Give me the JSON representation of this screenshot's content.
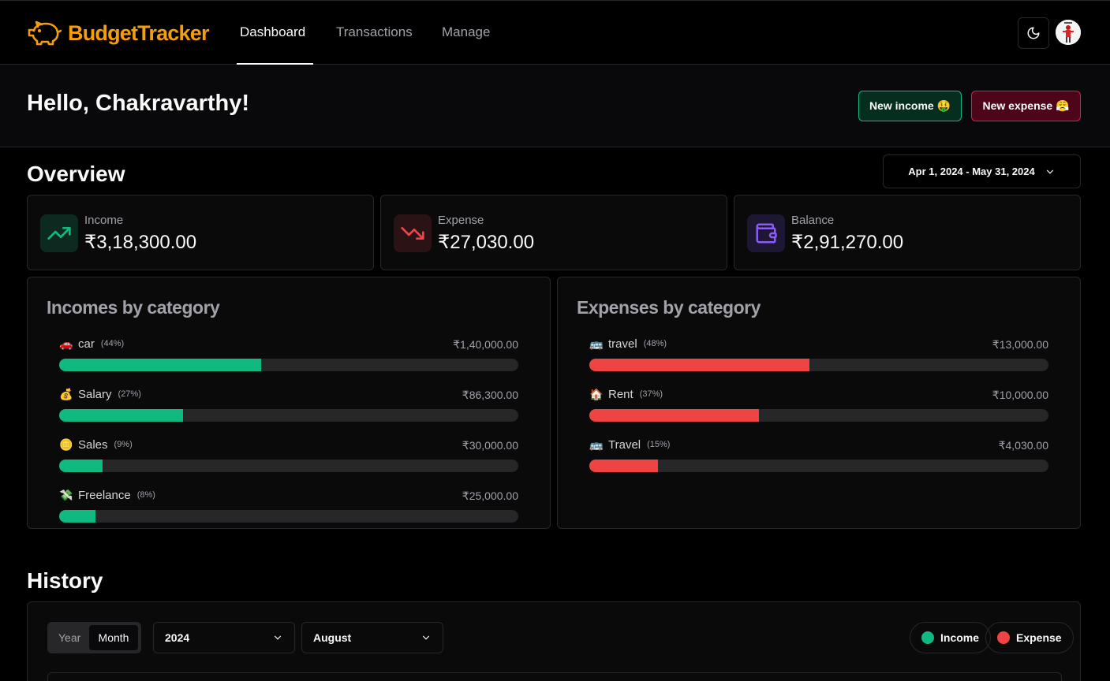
{
  "app": {
    "name": "BudgetTracker"
  },
  "nav": {
    "links": [
      {
        "label": "Dashboard",
        "active": true
      },
      {
        "label": "Transactions",
        "active": false
      },
      {
        "label": "Manage",
        "active": false
      }
    ],
    "theme_icon": "moon-icon"
  },
  "greeting": {
    "text": "Hello, Chakravarthy!",
    "new_income_label": "New income 🤑",
    "new_expense_label": "New expense 😤"
  },
  "overview": {
    "title": "Overview",
    "date_range": "Apr 1, 2024 - May 31, 2024",
    "stats": [
      {
        "label": "Income",
        "value": "₹3,18,300.00",
        "icon": "trending-up-icon",
        "color": "#10b981"
      },
      {
        "label": "Expense",
        "value": "₹27,030.00",
        "icon": "trending-down-icon",
        "color": "#ef4444"
      },
      {
        "label": "Balance",
        "value": "₹2,91,270.00",
        "icon": "wallet-icon",
        "color": "#8b5cf6"
      }
    ]
  },
  "incomes_by_category": {
    "title": "Incomes by category",
    "color": "#10b981",
    "items": [
      {
        "emoji": "🚗",
        "name": "car",
        "pct_label": "(44%)",
        "amount": "₹1,40,000.00",
        "fraction": 0.44
      },
      {
        "emoji": "💰",
        "name": "Salary",
        "pct_label": "(27%)",
        "amount": "₹86,300.00",
        "fraction": 0.27
      },
      {
        "emoji": "🪙",
        "name": "Sales",
        "pct_label": "(9%)",
        "amount": "₹30,000.00",
        "fraction": 0.094
      },
      {
        "emoji": "💸",
        "name": "Freelance",
        "pct_label": "(8%)",
        "amount": "₹25,000.00",
        "fraction": 0.079
      }
    ]
  },
  "expenses_by_category": {
    "title": "Expenses by category",
    "color": "#ef4444",
    "items": [
      {
        "emoji": "🚌",
        "name": "travel",
        "pct_label": "(48%)",
        "amount": "₹13,000.00",
        "fraction": 0.48
      },
      {
        "emoji": "🏠",
        "name": "Rent",
        "pct_label": "(37%)",
        "amount": "₹10,000.00",
        "fraction": 0.37
      },
      {
        "emoji": "🚌",
        "name": "Travel",
        "pct_label": "(15%)",
        "amount": "₹4,030.00",
        "fraction": 0.149
      }
    ]
  },
  "history": {
    "title": "History",
    "timeframe_options": [
      "Year",
      "Month"
    ],
    "timeframe_selected": "Month",
    "year_select": "2024",
    "month_select": "August",
    "legend": [
      {
        "label": "Income",
        "color": "#10b981"
      },
      {
        "label": "Expense",
        "color": "#ef4444"
      }
    ]
  }
}
